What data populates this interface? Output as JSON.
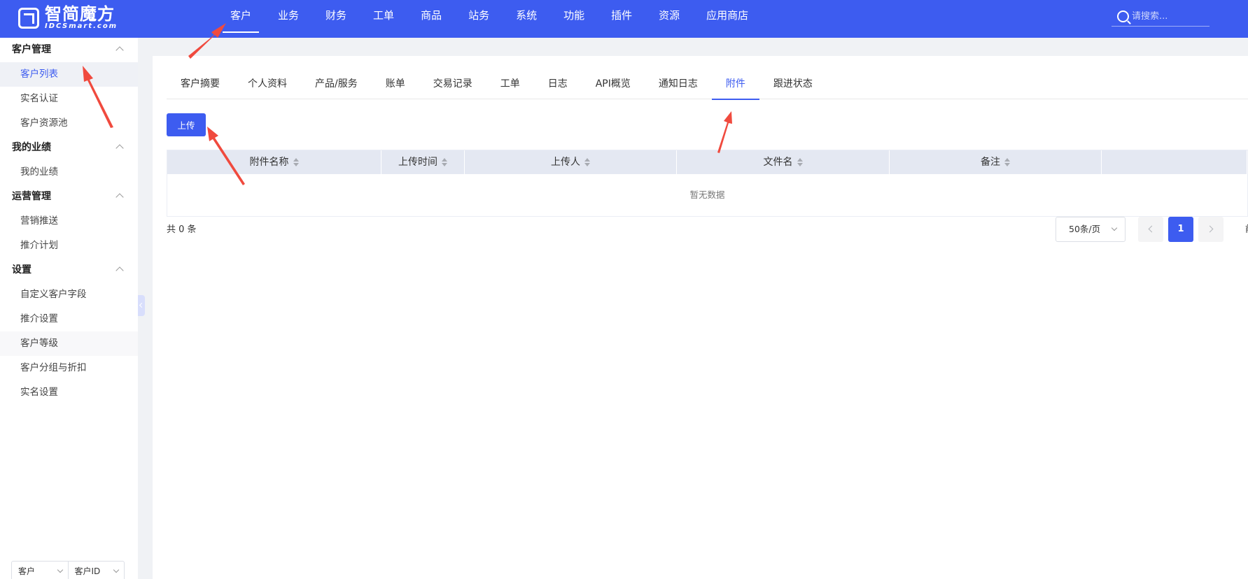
{
  "brand": {
    "name": "智简魔方",
    "subtitle": "IDCSmart.com"
  },
  "topnav": {
    "items": [
      "客户",
      "业务",
      "财务",
      "工单",
      "商品",
      "站务",
      "系统",
      "功能",
      "插件",
      "资源",
      "应用商店"
    ],
    "active_index": 0
  },
  "search": {
    "placeholder": "请搜索..."
  },
  "sidebar": {
    "groups": [
      {
        "title": "客户管理",
        "items": [
          "客户列表",
          "实名认证",
          "客户资源池"
        ]
      },
      {
        "title": "我的业绩",
        "items": [
          "我的业绩"
        ]
      },
      {
        "title": "运营管理",
        "items": [
          "营销推送",
          "推介计划"
        ]
      },
      {
        "title": "设置",
        "items": [
          "自定义客户字段",
          "推介设置",
          "客户等级",
          "客户分组与折扣",
          "实名设置"
        ]
      }
    ],
    "active_item": "客户列表",
    "footer": {
      "select_type": "客户",
      "select_field": "客户ID"
    }
  },
  "tabs": {
    "items": [
      "客户摘要",
      "个人资料",
      "产品/服务",
      "账单",
      "交易记录",
      "工单",
      "日志",
      "API概览",
      "通知日志",
      "附件",
      "跟进状态"
    ],
    "active_index": 9
  },
  "toolbar": {
    "upload_label": "上传"
  },
  "table": {
    "columns": [
      "附件名称",
      "上传时间",
      "上传人",
      "文件名",
      "备注"
    ],
    "empty_text": "暂无数据"
  },
  "pagination": {
    "total_text": "共 0 条",
    "page_size": "50条/页",
    "current_page": "1",
    "trailing_text": "前"
  },
  "colors": {
    "brand": "#3d5cf0",
    "annotation_arrow": "#f04a3e",
    "table_header": "#e4e8f2"
  }
}
